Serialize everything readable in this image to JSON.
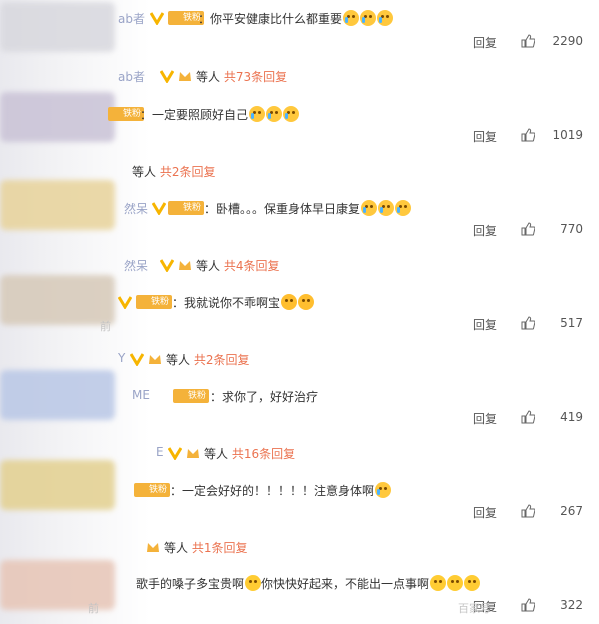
{
  "labels": {
    "reply": "回复",
    "fan_badge": "铁粉",
    "replies_prefix": "等人",
    "replies_link_prefix": "共",
    "replies_link_suffix": "条回复"
  },
  "comments": [
    {
      "user": "ab者",
      "text": "：你平安健康比什么都重要",
      "likes": "2290",
      "emoji": "crying-icon"
    },
    {
      "user": "",
      "text": "：一定要照顾好自己",
      "likes": "1019",
      "emoji": "crying-icon"
    },
    {
      "user": "然呆",
      "text": "：卧槽。。。保重身体早日康复",
      "likes": "770",
      "emoji": "crying-icon"
    },
    {
      "user": "",
      "text": "：我就说你不乖啊宝",
      "likes": "517",
      "emoji": "heart-icon"
    },
    {
      "user": "ME",
      "text": "：求你了，好好治疗",
      "likes": "419"
    },
    {
      "user": "",
      "text": "：一定会好好的！！！！！注意身体啊",
      "likes": "267",
      "emoji": "crying-icon"
    },
    {
      "user": "",
      "text": "歌手的嗓子多宝贵啊",
      "text2": "你快快好起来，不能出一点事啊",
      "likes": "322",
      "emoji": "worried-icon"
    }
  ],
  "reply_groups": [
    {
      "user": "ab者",
      "count": "73"
    },
    {
      "user": "",
      "count": "2"
    },
    {
      "user": "然呆",
      "count": "4"
    },
    {
      "user": "Y",
      "count": "2"
    },
    {
      "user": "E",
      "count": "16"
    },
    {
      "user": "",
      "count": "1"
    }
  ],
  "watermark": "百家号",
  "side_fragments": [
    "前",
    "前"
  ]
}
